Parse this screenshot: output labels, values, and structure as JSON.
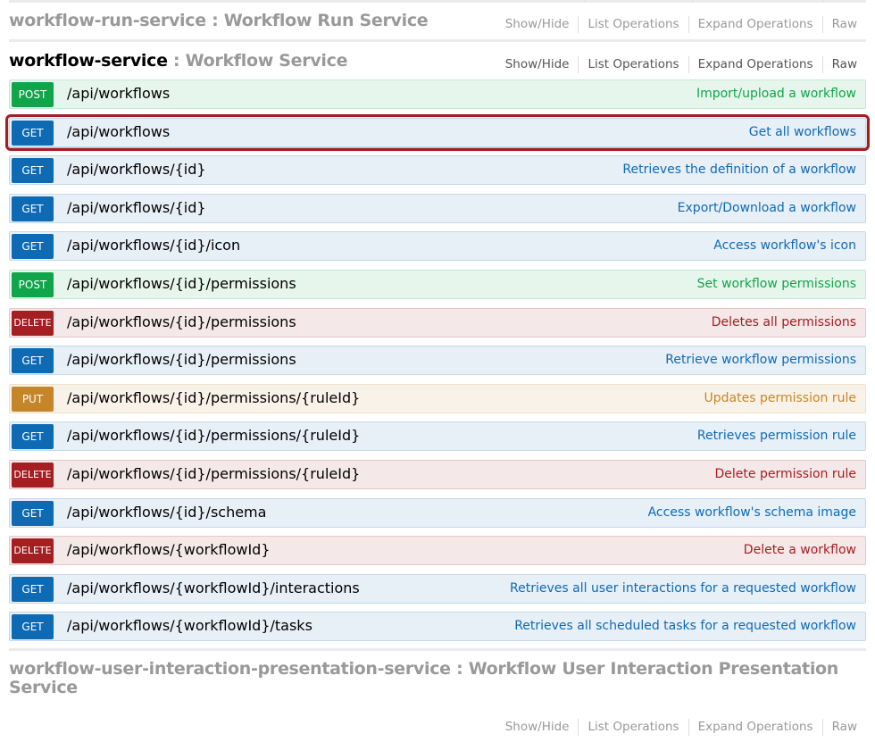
{
  "resources": [
    {
      "name": "workflow-run-service",
      "separator": " : ",
      "description": "Workflow Run Service",
      "active": false,
      "actions": [
        "Show/Hide",
        "List Operations",
        "Expand Operations",
        "Raw"
      ]
    },
    {
      "name": "workflow-service",
      "separator": " : ",
      "description": "Workflow Service",
      "active": true,
      "actions": [
        "Show/Hide",
        "List Operations",
        "Expand Operations",
        "Raw"
      ]
    },
    {
      "name": "workflow-user-interaction-presentation-service",
      "separator": " : ",
      "description": "Workflow User Interaction Presentation Service",
      "active": false,
      "actions": [
        "Show/Hide",
        "List Operations",
        "Expand Operations",
        "Raw"
      ]
    }
  ],
  "operations": [
    {
      "method": "POST",
      "path": "/api/workflows",
      "summary": "Import/upload a workflow",
      "highlighted": false
    },
    {
      "method": "GET",
      "path": "/api/workflows",
      "summary": "Get all workflows",
      "highlighted": true
    },
    {
      "method": "GET",
      "path": "/api/workflows/{id}",
      "summary": "Retrieves the definition of a workflow",
      "highlighted": false
    },
    {
      "method": "GET",
      "path": "/api/workflows/{id}",
      "summary": "Export/Download a workflow",
      "highlighted": false
    },
    {
      "method": "GET",
      "path": "/api/workflows/{id}/icon",
      "summary": "Access workflow's icon",
      "highlighted": false
    },
    {
      "method": "POST",
      "path": "/api/workflows/{id}/permissions",
      "summary": "Set workflow permissions",
      "highlighted": false
    },
    {
      "method": "DELETE",
      "path": "/api/workflows/{id}/permissions",
      "summary": "Deletes all permissions",
      "highlighted": false
    },
    {
      "method": "GET",
      "path": "/api/workflows/{id}/permissions",
      "summary": "Retrieve workflow permissions",
      "highlighted": false
    },
    {
      "method": "PUT",
      "path": "/api/workflows/{id}/permissions/{ruleId}",
      "summary": "Updates permission rule",
      "highlighted": false
    },
    {
      "method": "GET",
      "path": "/api/workflows/{id}/permissions/{ruleId}",
      "summary": "Retrieves permission rule",
      "highlighted": false
    },
    {
      "method": "DELETE",
      "path": "/api/workflows/{id}/permissions/{ruleId}",
      "summary": "Delete permission rule",
      "highlighted": false
    },
    {
      "method": "GET",
      "path": "/api/workflows/{id}/schema",
      "summary": "Access workflow's schema image",
      "highlighted": false
    },
    {
      "method": "DELETE",
      "path": "/api/workflows/{workflowId}",
      "summary": "Delete a workflow",
      "highlighted": false
    },
    {
      "method": "GET",
      "path": "/api/workflows/{workflowId}/interactions",
      "summary": "Retrieves all user interactions for a requested workflow",
      "highlighted": false
    },
    {
      "method": "GET",
      "path": "/api/workflows/{workflowId}/tasks",
      "summary": "Retrieves all scheduled tasks for a requested workflow",
      "highlighted": false
    }
  ],
  "colors": {
    "get": "#0f6ab4",
    "post": "#10a54a",
    "delete": "#a41e22",
    "put": "#c5862b",
    "highlight_border": "#a51d22"
  }
}
